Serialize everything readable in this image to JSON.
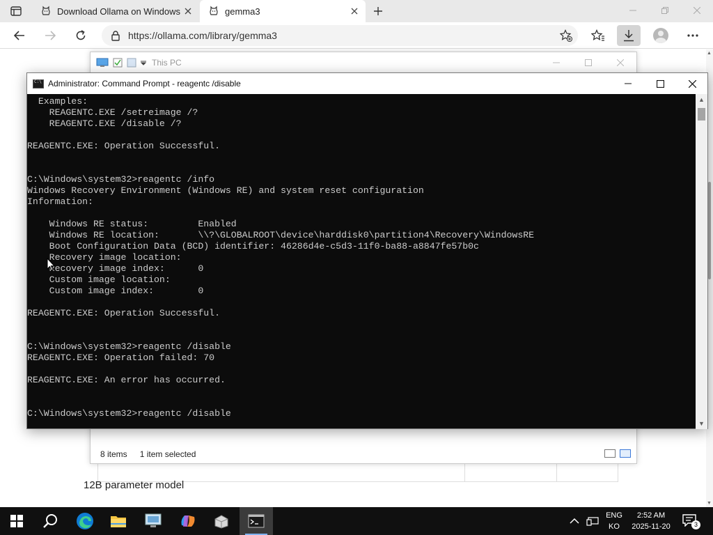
{
  "browser": {
    "tabs": [
      {
        "label": "Download Ollama on Windows",
        "active": false
      },
      {
        "label": "gemma3",
        "active": true
      }
    ],
    "url": "https://ollama.com/library/gemma3"
  },
  "page": {
    "caption": "12B parameter model"
  },
  "explorer": {
    "title": "This PC",
    "status_items": "8 items",
    "status_selected": "1 item selected"
  },
  "cmd": {
    "title": "Administrator: Command Prompt - reagentc  /disable",
    "lines": [
      "  Examples:",
      "    REAGENTC.EXE /setreimage /?",
      "    REAGENTC.EXE /disable /?",
      "",
      "REAGENTC.EXE: Operation Successful.",
      "",
      "",
      "C:\\Windows\\system32>reagentc /info",
      "Windows Recovery Environment (Windows RE) and system reset configuration",
      "Information:",
      "",
      "    Windows RE status:         Enabled",
      "    Windows RE location:       \\\\?\\GLOBALROOT\\device\\harddisk0\\partition4\\Recovery\\WindowsRE",
      "    Boot Configuration Data (BCD) identifier: 46286d4e-c5d3-11f0-ba88-a8847fe57b0c",
      "    Recovery image location:",
      "    Recovery image index:      0",
      "    Custom image location:",
      "    Custom image index:        0",
      "",
      "REAGENTC.EXE: Operation Successful.",
      "",
      "",
      "C:\\Windows\\system32>reagentc /disable",
      "REAGENTC.EXE: Operation failed: 70",
      "",
      "REAGENTC.EXE: An error has occurred.",
      "",
      "",
      "C:\\Windows\\system32>reagentc /disable"
    ]
  },
  "taskbar": {
    "apps": [
      "start-icon",
      "search-icon",
      "edge-icon",
      "file-explorer-icon",
      "remote-desktop-icon",
      "copilot-icon",
      "installer-icon",
      "command-prompt-icon"
    ],
    "lang_top": "ENG",
    "lang_bottom": "KO",
    "time": "2:52 AM",
    "date": "2025-11-20",
    "notification_count": "3"
  },
  "colors": {
    "console_bg": "#0c0c0c",
    "console_text": "#cccccc",
    "taskbar_bg": "#101010",
    "accent": "#0078d4"
  }
}
